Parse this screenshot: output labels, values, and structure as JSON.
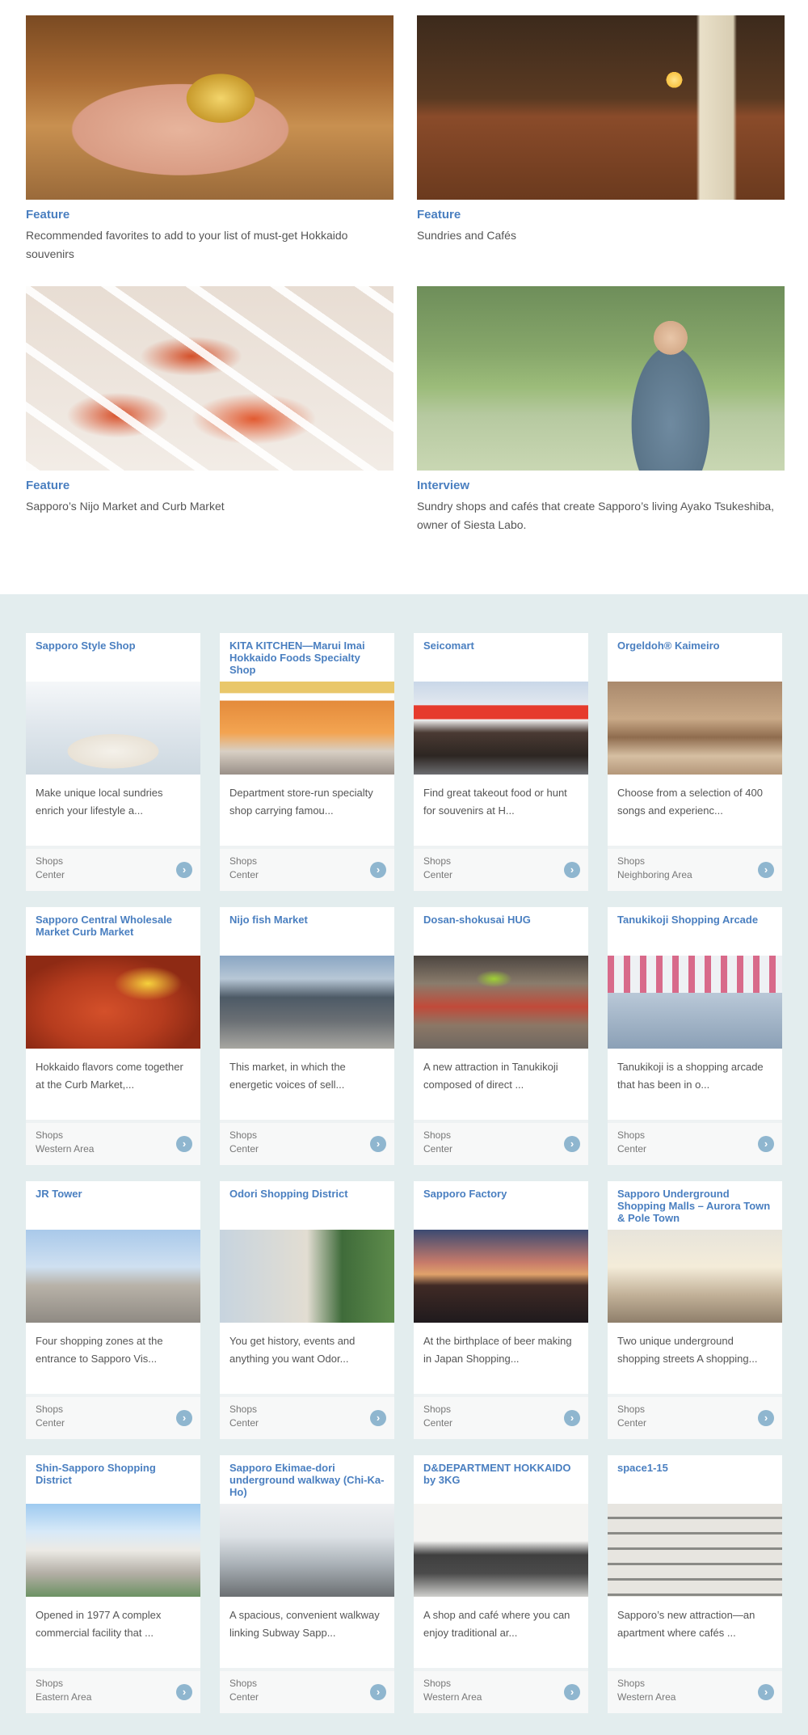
{
  "features": [
    {
      "category": "Feature",
      "description": "Recommended favorites to add to your list of must-get Hokkaido souvenirs",
      "image": "music-box-photo"
    },
    {
      "category": "Feature",
      "description": "Sundries and Cafés",
      "image": "cafe-interior-photo"
    },
    {
      "category": "Feature",
      "description": "Sapporo’s Nijo Market and Curb Market",
      "image": "crab-market-photo"
    },
    {
      "category": "Interview",
      "description": "Sundry shops and cafés that create Sapporo’s living Ayako Tsukeshiba, owner of Siesta Labo.",
      "image": "interview-portrait-photo"
    }
  ],
  "shops": [
    {
      "title": "Sapporo Style Shop",
      "text": "Make unique local sundries enrich your lifestyle a...",
      "category": "Shops",
      "area": "Center"
    },
    {
      "title": "KITA KITCHEN—Marui Imai Hokkaido Foods Specialty Shop",
      "text": "Department store-run specialty shop carrying famou...",
      "category": "Shops",
      "area": "Center"
    },
    {
      "title": "Seicomart",
      "text": "Find great takeout food or hunt for souvenirs at H...",
      "category": "Shops",
      "area": "Center"
    },
    {
      "title": "Orgeldoh® Kaimeiro",
      "text": "Choose from a selection of 400 songs and experienc...",
      "category": "Shops",
      "area": "Neighboring Area"
    },
    {
      "title": "Sapporo Central Wholesale Market Curb Market",
      "text": "Hokkaido flavors come together at the Curb Market,...",
      "category": "Shops",
      "area": "Western Area"
    },
    {
      "title": "Nijo fish Market",
      "text": "This market, in which the energetic voices of sell...",
      "category": "Shops",
      "area": "Center"
    },
    {
      "title": "Dosan-shokusai HUG",
      "text": "A new attraction in Tanukikoji composed of direct ...",
      "category": "Shops",
      "area": "Center"
    },
    {
      "title": "Tanukikoji Shopping Arcade",
      "text": "Tanukikoji is a shopping arcade that has been in o...",
      "category": "Shops",
      "area": "Center"
    },
    {
      "title": "JR Tower",
      "text": "Four shopping zones at the entrance to Sapporo Vis...",
      "category": "Shops",
      "area": "Center"
    },
    {
      "title": "Odori Shopping District",
      "text": "You get history, events and anything you want Odor...",
      "category": "Shops",
      "area": "Center"
    },
    {
      "title": "Sapporo Factory",
      "text": "At the birthplace of beer making in Japan Shopping...",
      "category": "Shops",
      "area": "Center"
    },
    {
      "title": "Sapporo Underground Shopping Malls – Aurora Town & Pole Town",
      "text": "Two unique underground shopping streets A shopping...",
      "category": "Shops",
      "area": "Center"
    },
    {
      "title": "Shin-Sapporo Shopping District",
      "text": "Opened in 1977 A complex commercial facility that ...",
      "category": "Shops",
      "area": "Eastern Area"
    },
    {
      "title": "Sapporo Ekimae-dori underground walkway (Chi-Ka-Ho)",
      "text": "A spacious, convenient walkway linking Subway Sapp...",
      "category": "Shops",
      "area": "Center"
    },
    {
      "title": "D&DEPARTMENT HOKKAIDO by 3KG",
      "text": "A shop and café where you can enjoy traditional ar...",
      "category": "Shops",
      "area": "Western Area"
    },
    {
      "title": "space1-15",
      "text": "Sapporo’s new attraction—an apartment where cafés ...",
      "category": "Shops",
      "area": "Western Area"
    }
  ],
  "arrow_icon": "chevron-right-icon",
  "colors": {
    "accent": "#4a7fc0",
    "section_bg": "#e3edee",
    "arrow": "#8fb6cf"
  }
}
